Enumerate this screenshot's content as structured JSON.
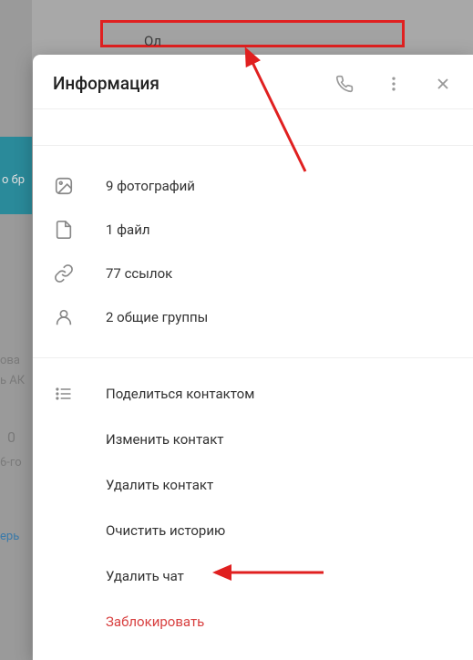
{
  "top_highlight_text": "Ол",
  "panel": {
    "title": "Информация"
  },
  "media": {
    "photos": "9 фотографий",
    "files": "1 файл",
    "links": "77 ссылок",
    "groups": "2 общие группы"
  },
  "actions": {
    "share": "Поделиться контактом",
    "edit": "Изменить контакт",
    "delete_contact": "Удалить контакт",
    "clear_history": "Очистить историю",
    "delete_chat": "Удалить чат",
    "block": "Заблокировать"
  },
  "bg": {
    "t1": "о бр",
    "t2": "ова",
    "t3": "ь АК",
    "t4": "0",
    "t5": "6-го",
    "t6": "ерь"
  }
}
